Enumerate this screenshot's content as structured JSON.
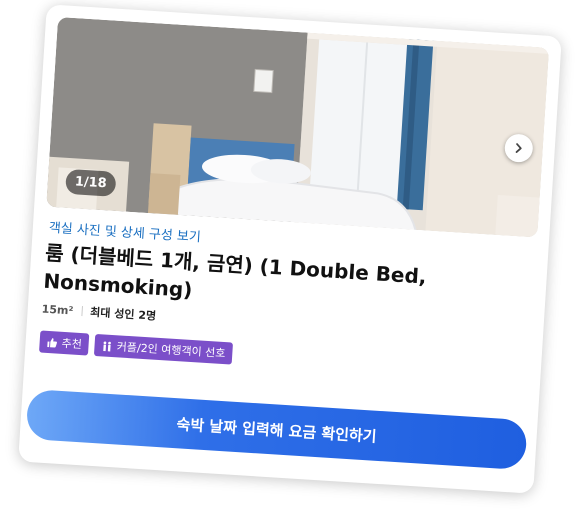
{
  "room": {
    "photo": {
      "counter": "1/18",
      "next_icon": "chevron-right-icon"
    },
    "detail_link": "객실 사진 및 상세 구성 보기",
    "title": "룸 (더블베드 1개, 금연) (1 Double Bed, Nonsmoking)",
    "size": "15m²",
    "occupancy": "최대 성인 2명",
    "tags": [
      {
        "icon": "thumbs-up-icon",
        "label": "추천"
      },
      {
        "icon": "people-icon",
        "label": "커플/2인 여행객이 선호"
      }
    ],
    "cta_label": "숙박 날짜 입력해 요금 확인하기"
  },
  "colors": {
    "link": "#1a6fc1",
    "tag_bg": "#7b4fc9",
    "cta_start": "#6ea8f7",
    "cta_end": "#1f5fe0"
  }
}
